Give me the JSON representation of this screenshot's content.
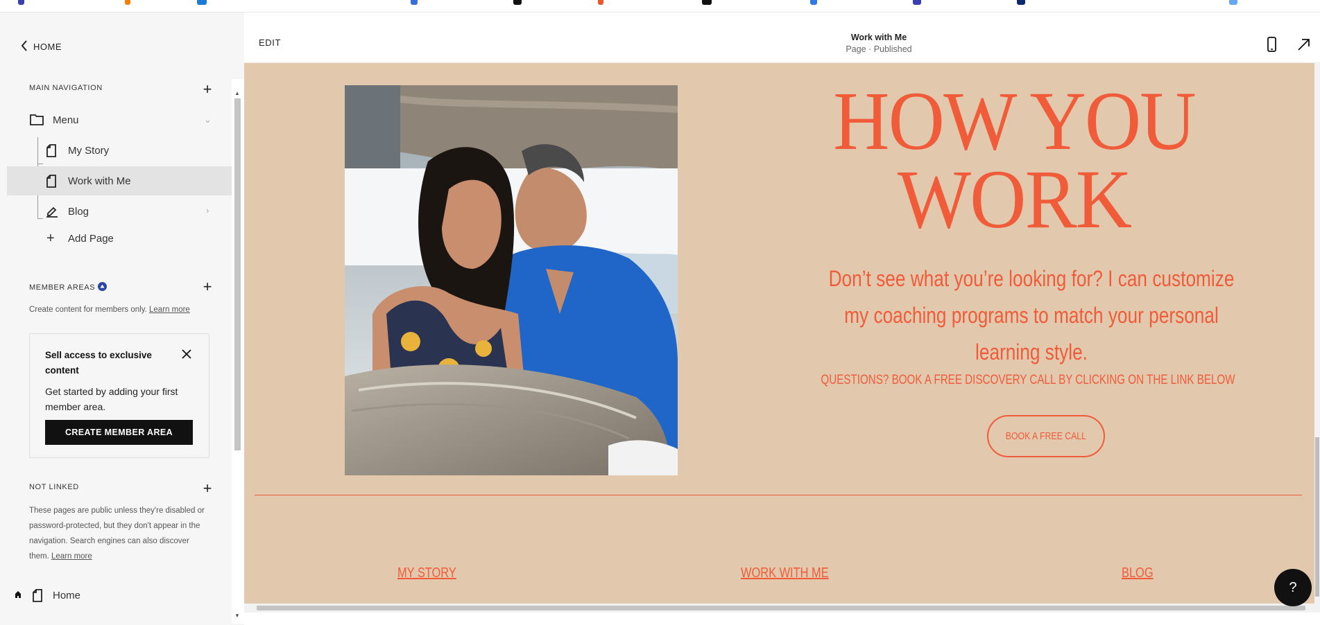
{
  "sidebar": {
    "home_label": "HOME",
    "main_navigation": {
      "title": "MAIN NAVIGATION",
      "folder": "Menu",
      "items": [
        {
          "label": "My Story"
        },
        {
          "label": "Work with Me"
        },
        {
          "label": "Blog"
        }
      ],
      "add_page": "Add Page"
    },
    "member_areas": {
      "title": "MEMBER AREAS",
      "note": "Create content for members only.",
      "learn_more": "Learn more",
      "promo": {
        "title": "Sell access to exclusive content",
        "body": "Get started by adding your first member area.",
        "button": "CREATE MEMBER AREA"
      }
    },
    "not_linked": {
      "title": "NOT LINKED",
      "note": "These pages are public unless they're disabled or password-protected, but they don't appear in the navigation. Search engines can also discover them.",
      "learn_more": "Learn more",
      "home_page": "Home"
    }
  },
  "editor": {
    "edit_label": "EDIT",
    "page_title": "Work with Me",
    "page_status": "Page · Published"
  },
  "page": {
    "headline_line1": "HOW YOU",
    "headline_line2": "WORK",
    "subtext": "Don’t see what you’re looking for? I can customize my coaching programs to match your personal learning style.",
    "question": "QUESTIONS? BOOK A FREE DISCOVERY CALL BY CLICKING ON THE LINK BELOW",
    "cta": "BOOK A FREE CALL",
    "footer_links": [
      "MY STORY",
      "WORK WITH ME",
      "BLOG"
    ]
  },
  "help_label": "?",
  "colors": {
    "accent": "#f05c3a",
    "canvas_bg": "#e2c8ad",
    "sidebar_bg": "#f6f6f6"
  }
}
